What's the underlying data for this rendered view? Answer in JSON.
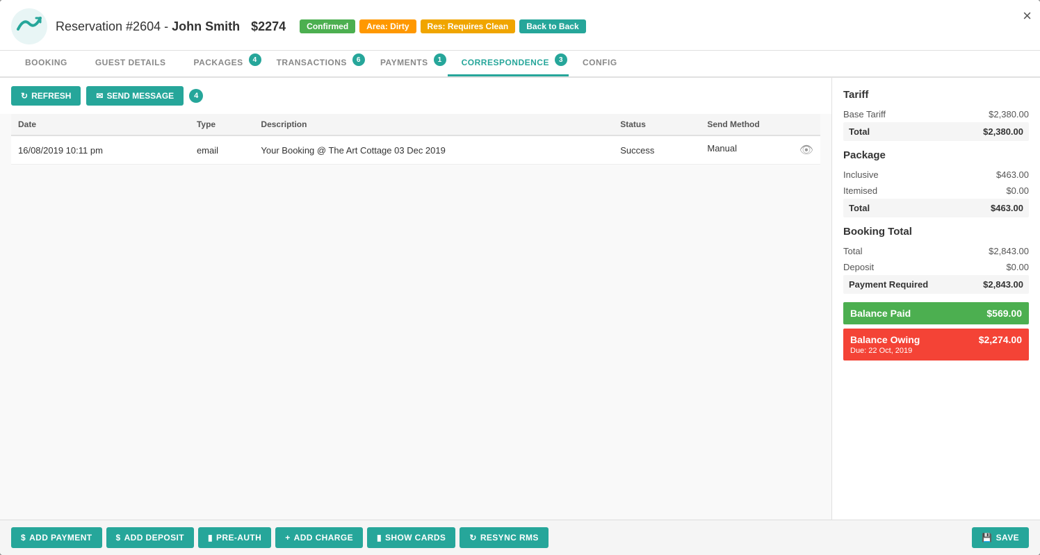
{
  "header": {
    "reservation_label": "Reservation #2604 - ",
    "guest_name": "John Smith",
    "amount": "$2274",
    "badges": [
      {
        "label": "Confirmed",
        "color": "green"
      },
      {
        "label": "Area: Dirty",
        "color": "orange"
      },
      {
        "label": "Res: Requires Clean",
        "color": "yellow"
      },
      {
        "label": "Back to Back",
        "color": "teal"
      }
    ],
    "close_label": "×"
  },
  "tabs": [
    {
      "label": "BOOKING",
      "active": false,
      "count": null
    },
    {
      "label": "GUEST DETAILS",
      "active": false,
      "count": null
    },
    {
      "label": "PACKAGES",
      "active": false,
      "count": "4"
    },
    {
      "label": "TRANSACTIONS",
      "active": false,
      "count": "6"
    },
    {
      "label": "PAYMENTS",
      "active": false,
      "count": "1"
    },
    {
      "label": "CORRESPONDENCE",
      "active": true,
      "count": "3"
    },
    {
      "label": "CONFIG",
      "active": false,
      "count": null
    }
  ],
  "toolbar": {
    "refresh_label": "REFRESH",
    "send_message_label": "SEND MESSAGE",
    "send_count": "4"
  },
  "table": {
    "columns": [
      "Date",
      "Type",
      "Description",
      "Status",
      "Send Method"
    ],
    "rows": [
      {
        "date": "16/08/2019 10:11 pm",
        "type": "email",
        "description": "Your Booking @ The Art Cottage 03 Dec 2019",
        "status": "Success",
        "send_method": "Manual"
      }
    ]
  },
  "sidebar": {
    "tariff_title": "Tariff",
    "base_tariff_label": "Base Tariff",
    "base_tariff_value": "$2,380.00",
    "tariff_total_label": "Total",
    "tariff_total_value": "$2,380.00",
    "package_title": "Package",
    "inclusive_label": "Inclusive",
    "inclusive_value": "$463.00",
    "itemised_label": "Itemised",
    "itemised_value": "$0.00",
    "package_total_label": "Total",
    "package_total_value": "$463.00",
    "booking_total_title": "Booking Total",
    "booking_total_label": "Total",
    "booking_total_value": "$2,843.00",
    "deposit_label": "Deposit",
    "deposit_value": "$0.00",
    "payment_required_label": "Payment Required",
    "payment_required_value": "$2,843.00",
    "balance_paid_label": "Balance Paid",
    "balance_paid_value": "$569.00",
    "balance_owing_label": "Balance Owing",
    "balance_owing_value": "$2,274.00",
    "due_label": "Due: 22 Oct, 2019"
  },
  "footer": {
    "add_payment": "ADD PAYMENT",
    "add_deposit": "ADD DEPOSIT",
    "pre_auth": "PRE-AUTH",
    "add_charge": "ADD CHARGE",
    "show_cards": "SHOW CARDS",
    "resync_rms": "RESYNC RMS",
    "save": "SAVE"
  }
}
